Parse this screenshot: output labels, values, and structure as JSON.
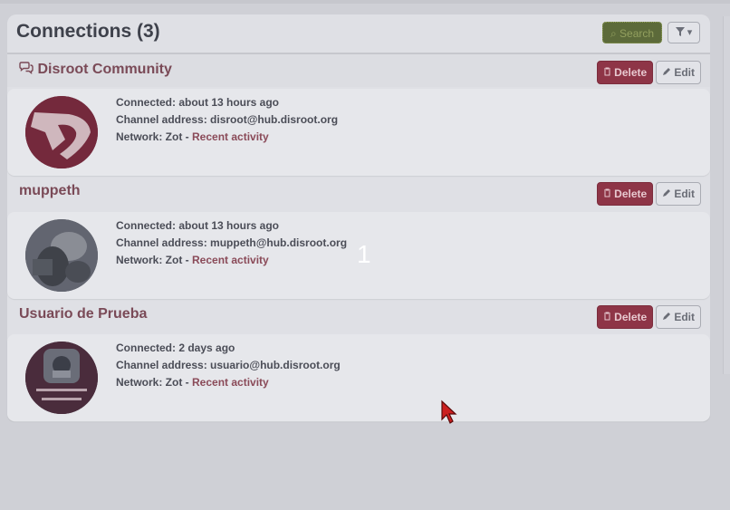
{
  "page": {
    "title": "Connections (3)",
    "search_label": "Search",
    "filter_caret": "▾",
    "overlay_number": "1"
  },
  "connections": [
    {
      "name": "Disroot Community",
      "connected": "Connected: about 13 hours ago",
      "address": "Channel address: disroot@hub.disroot.org",
      "network_prefix": "Network: Zot - ",
      "activity_link": "Recent activity",
      "delete_label": "Delete",
      "edit_label": "Edit"
    },
    {
      "name": "muppeth",
      "connected": "Connected: about 13 hours ago",
      "address": "Channel address: muppeth@hub.disroot.org",
      "network_prefix": "Network: Zot - ",
      "activity_link": "Recent activity",
      "delete_label": "Delete",
      "edit_label": "Edit"
    },
    {
      "name": "Usuario de Prueba",
      "connected": "Connected: 2 days ago",
      "address": "Channel address: usuario@hub.disroot.org",
      "network_prefix": "Network: Zot - ",
      "activity_link": "Recent activity",
      "delete_label": "Delete",
      "edit_label": "Edit"
    }
  ],
  "icons": {
    "comments": "comments-icon",
    "trash": "trash-icon",
    "pencil": "pencil-icon",
    "search": "search-icon",
    "filter": "filter-icon"
  },
  "colors": {
    "delete_bg": "#8e3547",
    "search_bg": "#5c6a3a",
    "name_color": "#7a4a57"
  }
}
